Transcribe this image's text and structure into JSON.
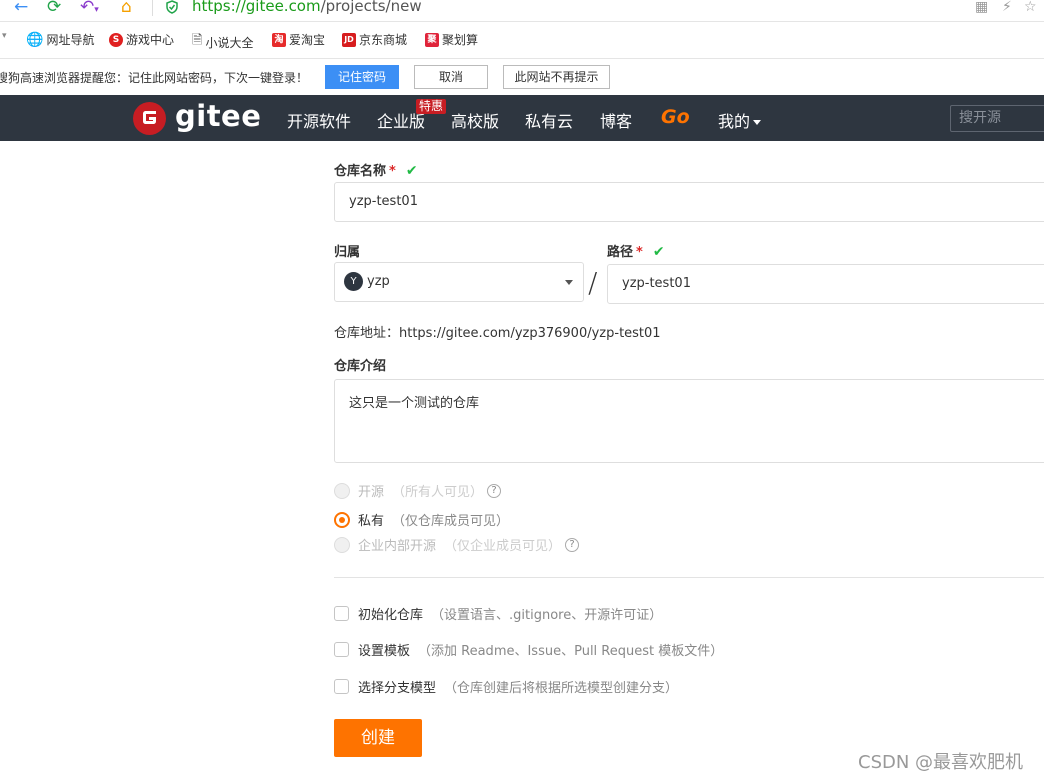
{
  "browser": {
    "url_host": "https://gitee.com",
    "url_path": "/projects/new",
    "bookmarks": [
      "网址导航",
      "游戏中心",
      "小说大全",
      "爱淘宝",
      "京东商城",
      "聚划算"
    ],
    "bookmark_icon_chars": [
      "S",
      "淘",
      "JD",
      "聚"
    ],
    "password_prompt": {
      "text": "搜狗高速浏览器提醒您：记住此网站密码，下次一键登录！",
      "remember": "记住密码",
      "cancel": "取消",
      "never": "此网站不再提示"
    }
  },
  "header": {
    "logo": "gitee",
    "nav": [
      "开源软件",
      "企业版",
      "高校版",
      "私有云",
      "博客",
      "Go",
      "我的"
    ],
    "badge": "特惠",
    "search_placeholder": "搜开源"
  },
  "form": {
    "repo_name_label": "仓库名称",
    "repo_name_required": "*",
    "repo_name_value": "yzp-test01",
    "owner_label": "归属",
    "owner_avatar": "Y",
    "owner_value": "yzp",
    "slash": "/",
    "path_label": "路径",
    "path_required": "*",
    "path_value": "yzp-test01",
    "repo_address": "仓库地址：https://gitee.com/yzp376900/yzp-test01",
    "desc_label": "仓库介绍",
    "desc_value": "这只是一个测试的仓库",
    "visibility": [
      {
        "label": "开源",
        "note": "（所有人可见）",
        "selected": false,
        "disabled": true
      },
      {
        "label": "私有",
        "note": "（仅仓库成员可见）",
        "selected": true,
        "disabled": false
      },
      {
        "label": "企业内部开源",
        "note": "（仅企业成员可见）",
        "selected": false,
        "disabled": true
      }
    ],
    "options": [
      {
        "label": "初始化仓库",
        "note": "（设置语言、.gitignore、开源许可证）"
      },
      {
        "label": "设置模板",
        "note": "（添加 Readme、Issue、Pull Request 模板文件）"
      },
      {
        "label": "选择分支模型",
        "note": "（仓库创建后将根据所选模型创建分支）"
      }
    ],
    "submit": "创建"
  },
  "watermark": "CSDN @最喜欢肥机",
  "colors": {
    "accent": "#fe7300",
    "header_bg": "#2e3640",
    "brand_red": "#c71d23",
    "check_green": "#21ba45"
  }
}
